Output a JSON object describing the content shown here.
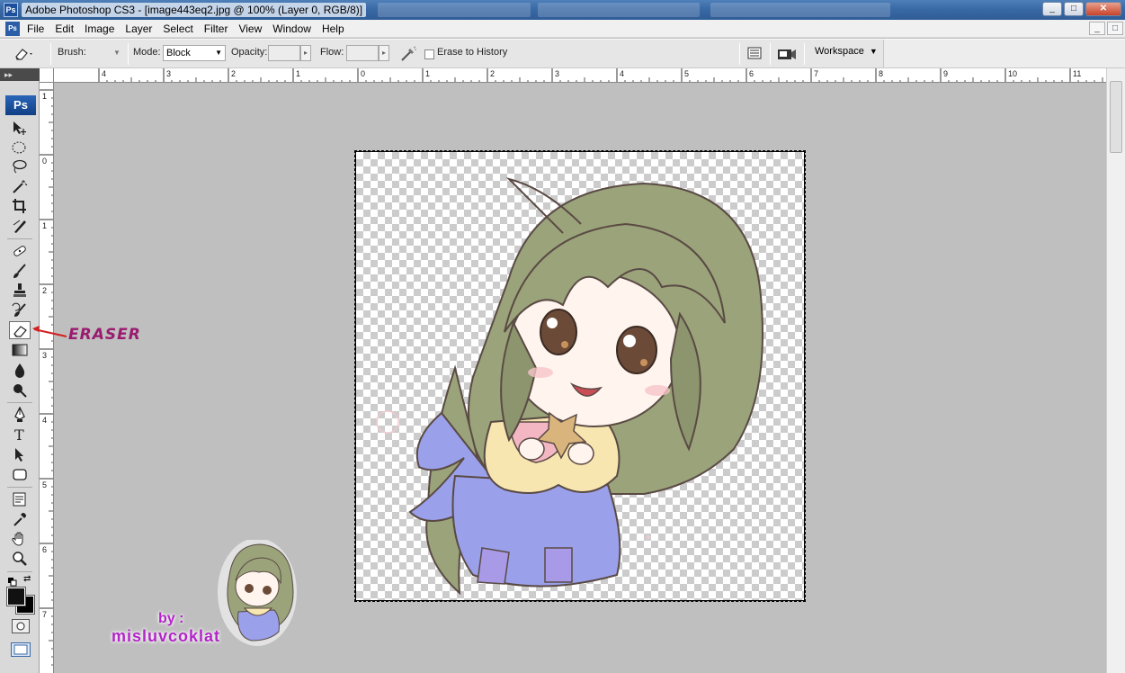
{
  "window": {
    "title": "Adobe Photoshop CS3 - [image443eq2.jpg @ 100% (Layer 0, RGB/8)]",
    "app_icon": "Ps",
    "controls": [
      "_",
      "□",
      "✕"
    ]
  },
  "menubar": {
    "items": [
      "File",
      "Edit",
      "Image",
      "Layer",
      "Select",
      "Filter",
      "View",
      "Window",
      "Help"
    ],
    "doc_controls": [
      "_",
      "□"
    ]
  },
  "options": {
    "brush_label": "Brush:",
    "brush_arrow": "▼",
    "mode_label": "Mode:",
    "mode_value": "Block",
    "opacity_label": "Opacity:",
    "opacity_value": "",
    "flow_label": "Flow:",
    "flow_value": "",
    "erase_history_label": "Erase to History",
    "workspace_label": "Workspace"
  },
  "rulers": {
    "horizontal_ticks": [
      "4",
      "3",
      "2",
      "1",
      "0",
      "1",
      "2",
      "3",
      "4",
      "5",
      "6",
      "7",
      "8",
      "9",
      "10",
      "11"
    ],
    "vertical_ticks": [
      "1",
      "0",
      "1",
      "2",
      "3",
      "4",
      "5",
      "6",
      "7"
    ]
  },
  "toolbar": {
    "logo": "Ps",
    "active_tool": "eraser-tool"
  },
  "annotation": {
    "label": "ERASER"
  },
  "credit": {
    "by": "by :",
    "name": "misluvcoklat"
  },
  "colors": {
    "titlebar": "#3a6aa6",
    "workspace_bg": "#bfbfbf",
    "annotation": "#9a1b6f",
    "credit": "#b325c8",
    "hair": "#9aa37a",
    "dress": "#9aa0ea"
  }
}
